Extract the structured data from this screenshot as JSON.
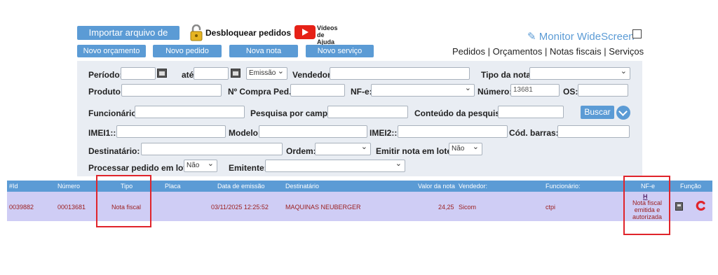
{
  "toolbar": {
    "help_button": "Importar arquivo de ajuda",
    "unlock_label": "Desbloquear pedidos",
    "video_badge_top": "YouTube",
    "video_badge_text": "Vídeos de Ajuda",
    "buttons": [
      "Novo orçamento",
      "Novo pedido",
      "Nova nota",
      "Novo serviço"
    ],
    "monitor_label": "Monitor WideScreen",
    "top_links": "Pedidos | Orçamentos | Notas fiscais | Serviços"
  },
  "filters": {
    "periodo": "Período:",
    "ate": "até",
    "emissao": "Emissão",
    "vendedor": "Vendedor:",
    "tipo_nota": "Tipo da nota:",
    "produto": "Produto:",
    "compra": "Nº Compra Ped.:",
    "nfe": "NF-e:",
    "numero": "Número:",
    "numero_value": "13681",
    "os": "OS:",
    "funcionario": "Funcionário:",
    "pesquisa_campo": "Pesquisa por campo:",
    "conteudo": "Conteúdo da pesquisa:",
    "buscar": "Buscar",
    "imei1": "IMEI1::",
    "modelo": "Modelo:",
    "imei2": "IMEI2::",
    "cod_barras": "Cód. barras:",
    "destinatario": "Destinatário:",
    "ordem": "Ordem:",
    "emitir_lote": "Emitir nota em lote:",
    "emitir_lote_value": "Não",
    "processar_lote": "Processar pedido em lote:",
    "processar_lote_value": "Não",
    "emitente": "Emitente:"
  },
  "table": {
    "headers": [
      "#Id",
      "Número",
      "Tipo",
      "Placa",
      "Data de emissão",
      "Destinatário",
      "Valor da nota",
      "Vendedor:",
      "Funcionário:",
      "NF-e",
      "Função"
    ],
    "row": {
      "id": "0039882",
      "numero": "00013681",
      "tipo": "Nota fiscal",
      "placa": "",
      "data": "03/11/2025 12:25:52",
      "destinatario": "MAQUINAS NEUBERGER",
      "valor": "24,25",
      "vendedor": "Sicom",
      "funcionario": "ctpi",
      "nfe_link": "H",
      "nfe_status": "Nota fiscal emitida e autorizada"
    }
  },
  "colors": {
    "accent": "#5b9bd5",
    "row_bg": "#cfcdf5",
    "row_text": "#9b1d1d",
    "highlight": "#e0242b"
  }
}
